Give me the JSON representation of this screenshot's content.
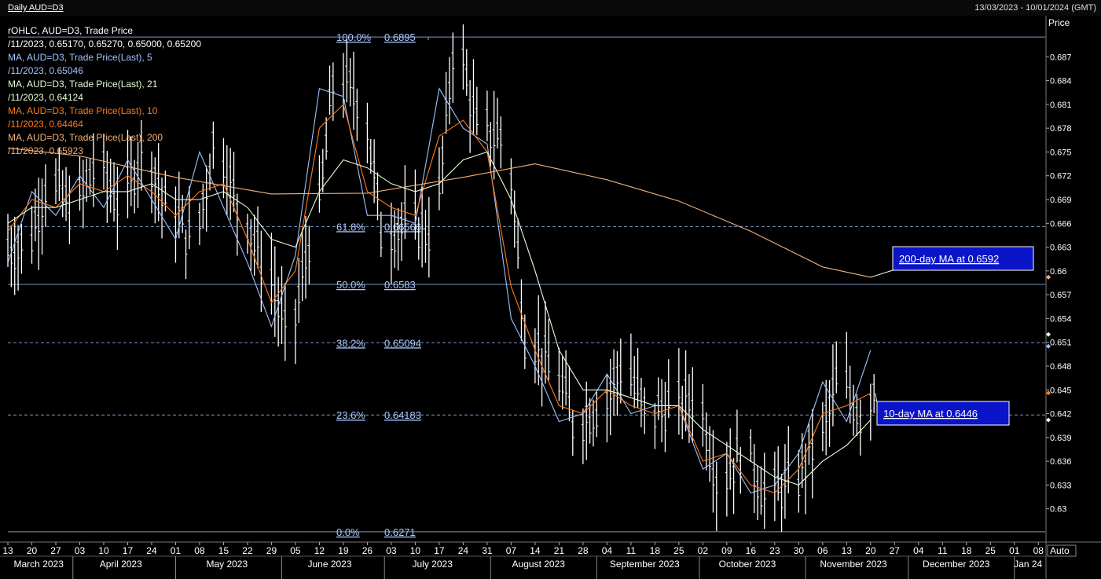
{
  "header": {
    "title": "Daily AUD=D3",
    "date_range": "13/03/2023 - 10/01/2024 (GMT)"
  },
  "legend": [
    {
      "text": "rOHLC, AUD=D3, Trade Price",
      "color": "#ffffff"
    },
    {
      "text": "/11/2023, 0.65170, 0.65270, 0.65000, 0.65200",
      "color": "#ffffff"
    },
    {
      "text": "MA, AUD=D3, Trade Price(Last),  5",
      "color": "#9fc3ff"
    },
    {
      "text": "/11/2023, 0.65046",
      "color": "#9fc3ff"
    },
    {
      "text": "MA, AUD=D3, Trade Price(Last),  21",
      "color": "#e6ffd6"
    },
    {
      "text": "/11/2023, 0.64124",
      "color": "#e6ffd6"
    },
    {
      "text": "MA, AUD=D3, Trade Price(Last),  10",
      "color": "#ff7a1a"
    },
    {
      "text": "/11/2023, 0.64464",
      "color": "#ff7a1a"
    },
    {
      "text": "MA, AUD=D3, Trade Price(Last),  200",
      "color": "#f2b27a"
    },
    {
      "text": "/11/2023, 0.65923",
      "color": "#f2b27a"
    }
  ],
  "axis": {
    "price_label": "Price",
    "auto_label": "Auto"
  },
  "annotations": {
    "ma200": "200-day MA at 0.6592",
    "ma10": "10-day MA at 0.6446 "
  },
  "colors": {
    "background": "#000000",
    "bars": "#ffffff",
    "ma5": "#9fc3ff",
    "ma10": "#ff7a1a",
    "ma21": "#e6ffd6",
    "ma200": "#f2b27a",
    "fib_label": "#a8c8ff",
    "annotation_box": "#0a14c8"
  },
  "chart_data": {
    "type": "line",
    "title": "Daily AUD=D3",
    "ylabel": "Price",
    "ylim": [
      0.6264,
      0.6902
    ],
    "y_ticks": [
      0.63,
      0.633,
      0.636,
      0.639,
      0.642,
      0.645,
      0.648,
      0.651,
      0.654,
      0.657,
      0.66,
      0.663,
      0.666,
      0.669,
      0.672,
      0.675,
      0.678,
      0.681,
      0.684,
      0.687
    ],
    "x_day_ticks": [
      {
        "date": "2023-03-13",
        "label": "13"
      },
      {
        "date": "2023-03-20",
        "label": "20"
      },
      {
        "date": "2023-03-27",
        "label": "27"
      },
      {
        "date": "2023-04-03",
        "label": "03"
      },
      {
        "date": "2023-04-10",
        "label": "10"
      },
      {
        "date": "2023-04-17",
        "label": "17"
      },
      {
        "date": "2023-04-24",
        "label": "24"
      },
      {
        "date": "2023-05-01",
        "label": "01"
      },
      {
        "date": "2023-05-08",
        "label": "08"
      },
      {
        "date": "2023-05-15",
        "label": "15"
      },
      {
        "date": "2023-05-22",
        "label": "22"
      },
      {
        "date": "2023-05-29",
        "label": "29"
      },
      {
        "date": "2023-06-05",
        "label": "05"
      },
      {
        "date": "2023-06-12",
        "label": "12"
      },
      {
        "date": "2023-06-19",
        "label": "19"
      },
      {
        "date": "2023-06-26",
        "label": "26"
      },
      {
        "date": "2023-07-03",
        "label": "03"
      },
      {
        "date": "2023-07-10",
        "label": "10"
      },
      {
        "date": "2023-07-17",
        "label": "17"
      },
      {
        "date": "2023-07-24",
        "label": "24"
      },
      {
        "date": "2023-07-31",
        "label": "31"
      },
      {
        "date": "2023-08-07",
        "label": "07"
      },
      {
        "date": "2023-08-14",
        "label": "14"
      },
      {
        "date": "2023-08-21",
        "label": "21"
      },
      {
        "date": "2023-08-28",
        "label": "28"
      },
      {
        "date": "2023-09-04",
        "label": "04"
      },
      {
        "date": "2023-09-11",
        "label": "11"
      },
      {
        "date": "2023-09-18",
        "label": "18"
      },
      {
        "date": "2023-09-25",
        "label": "25"
      },
      {
        "date": "2023-10-02",
        "label": "02"
      },
      {
        "date": "2023-10-09",
        "label": "09"
      },
      {
        "date": "2023-10-16",
        "label": "16"
      },
      {
        "date": "2023-10-23",
        "label": "23"
      },
      {
        "date": "2023-10-30",
        "label": "30"
      },
      {
        "date": "2023-11-06",
        "label": "06"
      },
      {
        "date": "2023-11-13",
        "label": "13"
      },
      {
        "date": "2023-11-20",
        "label": "20"
      },
      {
        "date": "2023-11-27",
        "label": "27"
      },
      {
        "date": "2023-12-04",
        "label": "04"
      },
      {
        "date": "2023-12-11",
        "label": "11"
      },
      {
        "date": "2023-12-18",
        "label": "18"
      },
      {
        "date": "2023-12-25",
        "label": "25"
      },
      {
        "date": "2024-01-01",
        "label": "01"
      },
      {
        "date": "2024-01-08",
        "label": "08"
      }
    ],
    "x_month_labels": [
      {
        "date": "2023-03-22",
        "label": "March 2023"
      },
      {
        "date": "2023-04-15",
        "label": "April 2023"
      },
      {
        "date": "2023-05-16",
        "label": "May 2023"
      },
      {
        "date": "2023-06-15",
        "label": "June 2023"
      },
      {
        "date": "2023-07-15",
        "label": "July 2023"
      },
      {
        "date": "2023-08-15",
        "label": "August 2023"
      },
      {
        "date": "2023-09-15",
        "label": "September 2023"
      },
      {
        "date": "2023-10-15",
        "label": "October 2023"
      },
      {
        "date": "2023-11-15",
        "label": "November 2023"
      },
      {
        "date": "2023-12-15",
        "label": "December 2023"
      },
      {
        "date": "2024-01-05",
        "label": "Jan 24"
      }
    ],
    "month_boundaries": [
      "2023-04-01",
      "2023-05-01",
      "2023-06-01",
      "2023-07-01",
      "2023-08-01",
      "2023-09-01",
      "2023-10-01",
      "2023-11-01",
      "2023-12-01",
      "2024-01-01"
    ],
    "fibonacci": [
      {
        "pct": "100.0%",
        "value": 0.6895,
        "label": "0.6895",
        "style": "solid"
      },
      {
        "pct": "61.8%",
        "value": 0.6656,
        "label": "0.66566",
        "style": "dashed"
      },
      {
        "pct": "50.0%",
        "value": 0.6583,
        "label": "0.6583",
        "style": "solid"
      },
      {
        "pct": "38.2%",
        "value": 0.65094,
        "label": "0.65094",
        "style": "dashed"
      },
      {
        "pct": "23.6%",
        "value": 0.64183,
        "label": "0.64183",
        "style": "dashed"
      },
      {
        "pct": "0.0%",
        "value": 0.6271,
        "label": "0.6271",
        "style": "solid"
      }
    ],
    "series": [
      {
        "name": "rOHLC, AUD=D3, Trade Price",
        "kind": "ohlc",
        "x": [
          "2023-03-13",
          "2023-03-20",
          "2023-03-27",
          "2023-04-03",
          "2023-04-10",
          "2023-04-17",
          "2023-04-24",
          "2023-05-01",
          "2023-05-08",
          "2023-05-15",
          "2023-05-22",
          "2023-05-29",
          "2023-06-05",
          "2023-06-12",
          "2023-06-19",
          "2023-06-26",
          "2023-07-03",
          "2023-07-10",
          "2023-07-17",
          "2023-07-24",
          "2023-07-31",
          "2023-08-07",
          "2023-08-14",
          "2023-08-21",
          "2023-08-28",
          "2023-09-04",
          "2023-09-11",
          "2023-09-18",
          "2023-09-25",
          "2023-10-02",
          "2023-10-09",
          "2023-10-16",
          "2023-10-23",
          "2023-10-30",
          "2023-11-06",
          "2023-11-13",
          "2023-11-20"
        ],
        "close": [
          0.663,
          0.671,
          0.668,
          0.673,
          0.669,
          0.675,
          0.668,
          0.664,
          0.676,
          0.668,
          0.661,
          0.652,
          0.664,
          0.684,
          0.682,
          0.665,
          0.666,
          0.665,
          0.688,
          0.678,
          0.677,
          0.652,
          0.648,
          0.641,
          0.643,
          0.648,
          0.642,
          0.643,
          0.644,
          0.634,
          0.637,
          0.632,
          0.633,
          0.638,
          0.646,
          0.642,
          0.652
        ]
      },
      {
        "name": "MA, AUD=D3, Trade Price(Last),  5",
        "x": [
          "2023-03-13",
          "2023-03-20",
          "2023-03-27",
          "2023-04-03",
          "2023-04-10",
          "2023-04-17",
          "2023-04-24",
          "2023-05-01",
          "2023-05-08",
          "2023-05-15",
          "2023-05-22",
          "2023-05-29",
          "2023-06-05",
          "2023-06-12",
          "2023-06-19",
          "2023-06-26",
          "2023-07-03",
          "2023-07-10",
          "2023-07-17",
          "2023-07-24",
          "2023-07-31",
          "2023-08-07",
          "2023-08-14",
          "2023-08-21",
          "2023-08-28",
          "2023-09-04",
          "2023-09-11",
          "2023-09-18",
          "2023-09-25",
          "2023-10-02",
          "2023-10-09",
          "2023-10-16",
          "2023-10-23",
          "2023-10-30",
          "2023-11-06",
          "2023-11-13",
          "2023-11-20"
        ],
        "values": [
          0.661,
          0.67,
          0.667,
          0.672,
          0.668,
          0.674,
          0.669,
          0.664,
          0.675,
          0.668,
          0.661,
          0.653,
          0.662,
          0.683,
          0.682,
          0.667,
          0.667,
          0.666,
          0.683,
          0.678,
          0.676,
          0.654,
          0.648,
          0.641,
          0.642,
          0.647,
          0.642,
          0.643,
          0.643,
          0.635,
          0.637,
          0.632,
          0.633,
          0.637,
          0.646,
          0.641,
          0.65
        ]
      },
      {
        "name": "MA, AUD=D3, Trade Price(Last),  10",
        "x": [
          "2023-03-13",
          "2023-03-20",
          "2023-03-27",
          "2023-04-03",
          "2023-04-10",
          "2023-04-17",
          "2023-04-24",
          "2023-05-01",
          "2023-05-08",
          "2023-05-15",
          "2023-05-22",
          "2023-05-29",
          "2023-06-05",
          "2023-06-12",
          "2023-06-19",
          "2023-06-26",
          "2023-07-03",
          "2023-07-10",
          "2023-07-17",
          "2023-07-24",
          "2023-07-31",
          "2023-08-07",
          "2023-08-14",
          "2023-08-21",
          "2023-08-28",
          "2023-09-04",
          "2023-09-11",
          "2023-09-18",
          "2023-09-25",
          "2023-10-02",
          "2023-10-09",
          "2023-10-16",
          "2023-10-23",
          "2023-10-30",
          "2023-11-06",
          "2023-11-13",
          "2023-11-20"
        ],
        "values": [
          0.665,
          0.669,
          0.668,
          0.671,
          0.67,
          0.672,
          0.67,
          0.667,
          0.67,
          0.671,
          0.664,
          0.656,
          0.66,
          0.678,
          0.681,
          0.67,
          0.668,
          0.667,
          0.677,
          0.679,
          0.675,
          0.658,
          0.65,
          0.643,
          0.642,
          0.645,
          0.643,
          0.642,
          0.643,
          0.636,
          0.637,
          0.633,
          0.632,
          0.635,
          0.642,
          0.643,
          0.6446
        ]
      },
      {
        "name": "MA, AUD=D3, Trade Price(Last),  21",
        "x": [
          "2023-03-13",
          "2023-03-20",
          "2023-03-27",
          "2023-04-03",
          "2023-04-10",
          "2023-04-17",
          "2023-04-24",
          "2023-05-01",
          "2023-05-08",
          "2023-05-15",
          "2023-05-22",
          "2023-05-29",
          "2023-06-05",
          "2023-06-12",
          "2023-06-19",
          "2023-06-26",
          "2023-07-03",
          "2023-07-10",
          "2023-07-17",
          "2023-07-24",
          "2023-07-31",
          "2023-08-07",
          "2023-08-14",
          "2023-08-21",
          "2023-08-28",
          "2023-09-04",
          "2023-09-11",
          "2023-09-18",
          "2023-09-25",
          "2023-10-02",
          "2023-10-09",
          "2023-10-16",
          "2023-10-23",
          "2023-10-30",
          "2023-11-06",
          "2023-11-13",
          "2023-11-20"
        ],
        "values": [
          0.666,
          0.668,
          0.668,
          0.669,
          0.67,
          0.67,
          0.671,
          0.669,
          0.669,
          0.67,
          0.668,
          0.664,
          0.663,
          0.67,
          0.674,
          0.673,
          0.671,
          0.67,
          0.671,
          0.674,
          0.675,
          0.669,
          0.66,
          0.65,
          0.645,
          0.645,
          0.644,
          0.643,
          0.643,
          0.64,
          0.638,
          0.636,
          0.634,
          0.633,
          0.636,
          0.638,
          0.6412
        ]
      },
      {
        "name": "MA, AUD=D3, Trade Price(Last),  200",
        "x": [
          "2023-03-13",
          "2023-04-03",
          "2023-05-01",
          "2023-05-29",
          "2023-06-26",
          "2023-07-24",
          "2023-08-14",
          "2023-09-04",
          "2023-09-25",
          "2023-10-16",
          "2023-11-06",
          "2023-11-20"
        ],
        "values": [
          0.6755,
          0.6745,
          0.6718,
          0.6697,
          0.6698,
          0.6718,
          0.6735,
          0.6715,
          0.6688,
          0.665,
          0.6605,
          0.6592
        ]
      }
    ]
  }
}
